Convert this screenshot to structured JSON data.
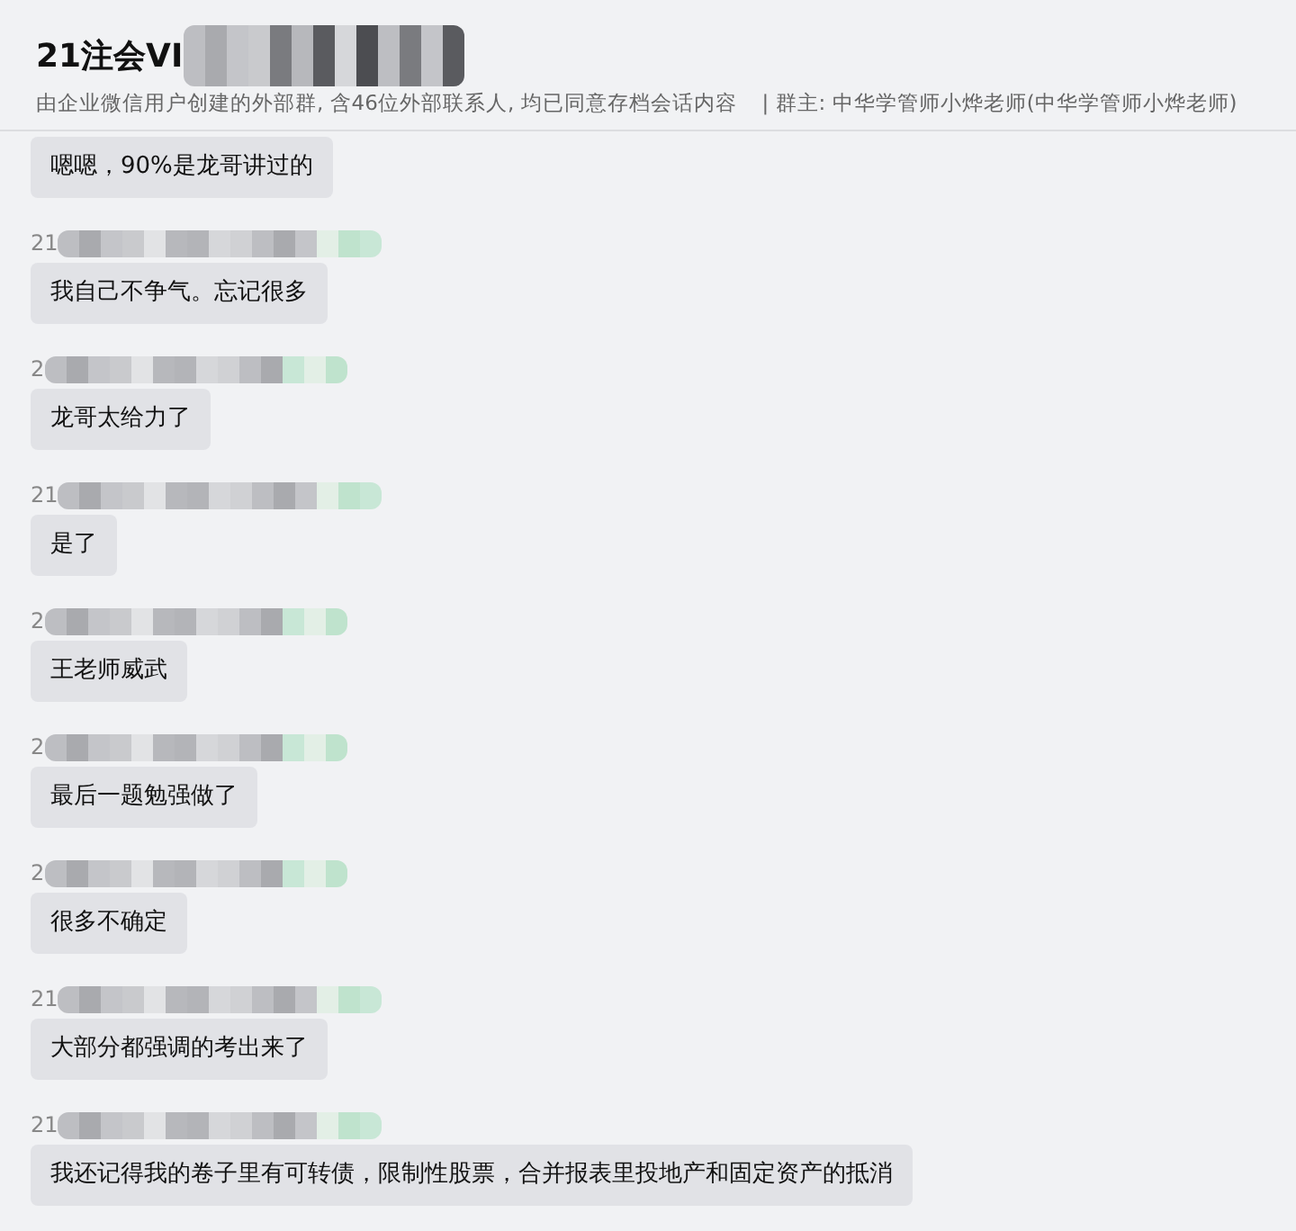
{
  "header": {
    "title": "21注会VI",
    "description": "由企业微信用户创建的外部群, 含46位外部联系人, 均已同意存档会话内容",
    "owner": "| 群主: 中华学管师小烨老师(中华学管师小烨老师)"
  },
  "messages": [
    {
      "text": "嗯嗯，90%是龙哥讲过的"
    },
    {
      "sender": "21",
      "text": "我自己不争气。忘记很多"
    },
    {
      "sender": "2",
      "text": "龙哥太给力了"
    },
    {
      "sender": "21",
      "text": "是了"
    },
    {
      "sender": "2",
      "text": "王老师威武"
    },
    {
      "sender": "2",
      "text": "最后一题勉强做了"
    },
    {
      "sender": "2",
      "text": "很多不确定"
    },
    {
      "sender": "21",
      "text": "大部分都强调的考出来了"
    },
    {
      "sender": "21",
      "text": "我还记得我的卷子里有可转债，限制性股票，合并报表里投地产和固定资产的抵消"
    }
  ]
}
